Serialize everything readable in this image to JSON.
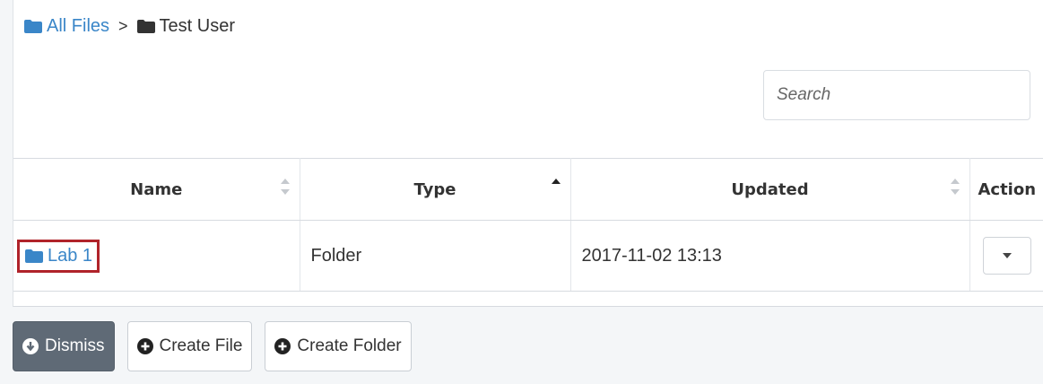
{
  "breadcrumb": {
    "root_label": "All Files",
    "separator": ">",
    "current_label": "Test User"
  },
  "search": {
    "placeholder": "Search",
    "value": ""
  },
  "table": {
    "columns": [
      {
        "label": "Name",
        "sort": "none"
      },
      {
        "label": "Type",
        "sort": "ascending"
      },
      {
        "label": "Updated",
        "sort": "none"
      },
      {
        "label": "Action",
        "sort": "none"
      }
    ],
    "rows": [
      {
        "name": "Lab 1",
        "type": "Folder",
        "updated": "2017-11-02 13:13",
        "icon": "folder-icon"
      }
    ]
  },
  "toolbar": {
    "dismiss_label": "Dismiss",
    "create_file_label": "Create File",
    "create_folder_label": "Create Folder"
  },
  "colors": {
    "link": "#3a86c8",
    "highlight_border": "#b0232a",
    "dark_button": "#5f6a76"
  }
}
